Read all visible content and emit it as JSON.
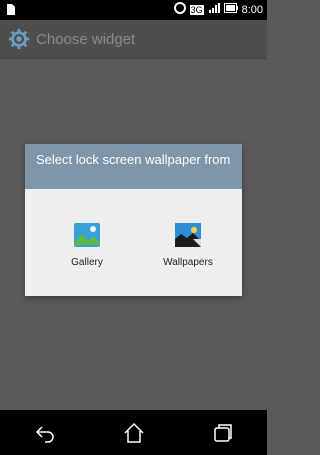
{
  "status_bar": {
    "network_label": "3G",
    "battery_label": "",
    "time": "8:00"
  },
  "app_bar": {
    "title": "Choose widget",
    "icon": "gear-icon"
  },
  "dialog": {
    "title": "Select lock screen wallpaper from",
    "options": [
      {
        "label": "Gallery",
        "icon": "gallery-icon"
      },
      {
        "label": "Wallpapers",
        "icon": "wallpapers-icon"
      }
    ]
  },
  "nav_bar": {
    "back_icon": "back-icon",
    "home_icon": "home-icon",
    "recents_icon": "recents-icon"
  }
}
